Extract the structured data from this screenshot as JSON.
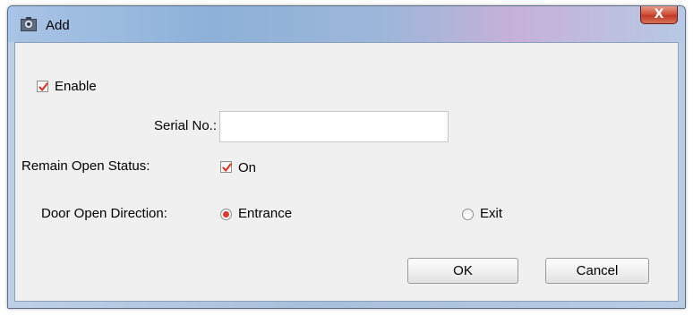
{
  "window": {
    "title": "Add",
    "close_glyph": "X",
    "app_icon": "camera-icon"
  },
  "form": {
    "enable": {
      "label": "Enable",
      "checked": true
    },
    "serial_no": {
      "label": "Serial No.:",
      "value": "",
      "placeholder": ""
    },
    "remain_open_status": {
      "label": "Remain Open Status:",
      "option_label": "On",
      "checked": true
    },
    "door_open_direction": {
      "label": "Door Open Direction:",
      "options": [
        {
          "label": "Entrance",
          "selected": true
        },
        {
          "label": "Exit",
          "selected": false
        }
      ]
    }
  },
  "buttons": {
    "ok": "OK",
    "cancel": "Cancel"
  },
  "colors": {
    "check_mark": "#d83a2c",
    "close_button": "#c9442d",
    "dialog_background": "#f0f0f0"
  }
}
